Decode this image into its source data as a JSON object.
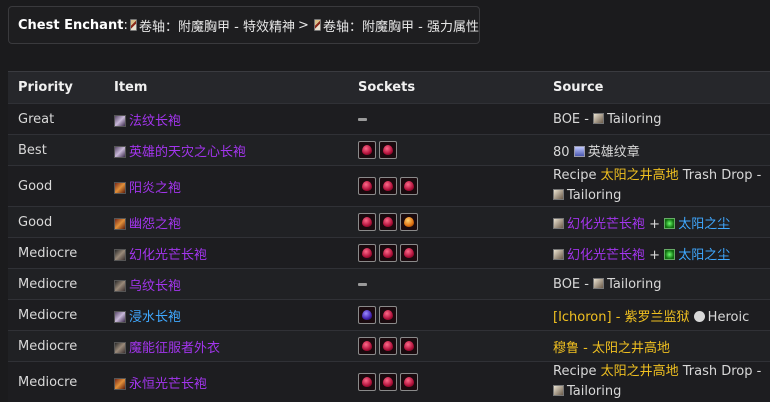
{
  "header": {
    "title": "Chest Enchant",
    "colon": ":",
    "enchant1": "卷轴：附魔胸甲 - 特效精神",
    "arrow": ">",
    "enchant2": "卷轴：附魔胸甲 - 强力属性"
  },
  "table": {
    "columns": [
      "Priority",
      "Item",
      "Sockets",
      "Source"
    ],
    "rows": [
      {
        "priority": "Great",
        "item": "法纹长袍",
        "src_a": "BOE - ",
        "src_b": "Tailoring"
      },
      {
        "priority": "Best",
        "item": "英雄的天灾之心长袍",
        "src_a": "80 ",
        "src_b": "英雄纹章"
      },
      {
        "priority": "Good",
        "item": "阳炎之袍",
        "src_a": "Recipe ",
        "src_b": "太阳之井高地",
        "src_c": " Trash Drop -",
        "src_d": "Tailoring"
      },
      {
        "priority": "Good",
        "item": "幽怨之袍",
        "src_a": "幻化光芒长袍",
        "src_plus": " + ",
        "src_b": "太阳之尘"
      },
      {
        "priority": "Mediocre",
        "item": "幻化光芒长袍",
        "src_a": "幻化光芒长袍",
        "src_plus": " + ",
        "src_b": "太阳之尘"
      },
      {
        "priority": "Mediocre",
        "item": "乌纹长袍",
        "src_a": "BOE - ",
        "src_b": "Tailoring"
      },
      {
        "priority": "Mediocre",
        "item": "浸水长袍",
        "src_a": "[Ichoron] - 紫罗兰监狱 ",
        "src_b": "Heroic"
      },
      {
        "priority": "Mediocre",
        "item": "魔能征服者外衣",
        "src_a": "穆鲁 - 太阳之井高地"
      },
      {
        "priority": "Mediocre",
        "item": "永恒光芒长袍",
        "src_a": "Recipe ",
        "src_b": "太阳之井高地",
        "src_c": " Trash Drop -",
        "src_d": "Tailoring"
      }
    ]
  },
  "icons": {
    "scroll": "scroll-icon",
    "robe": "robe-icon",
    "gem_red": "red-gem-icon",
    "gem_blue": "purple-gem-icon",
    "gem_orange": "orange-gem-icon",
    "pattern": "pattern-icon",
    "badge": "badge-icon",
    "dust": "dust-icon",
    "skull": "skull-icon"
  },
  "colors": {
    "epic": "#a335ee",
    "rare": "#3fa8ff",
    "legendary_orange": "#ffb400",
    "background": "#1b1b1d"
  }
}
